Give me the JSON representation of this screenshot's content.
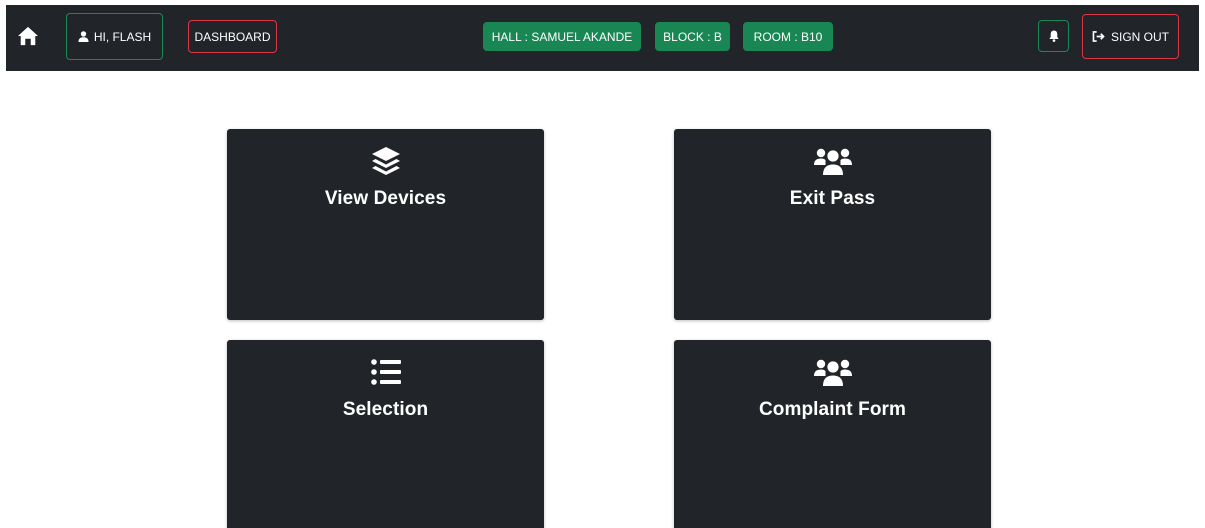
{
  "navbar": {
    "home_icon": "home-icon",
    "user_button": {
      "label": "HI, FLASH",
      "icon": "user-icon"
    },
    "dashboard_button": {
      "label": "DASHBOARD"
    },
    "badges": {
      "hall": "HALL : SAMUEL AKANDE",
      "block": "BLOCK : B",
      "room": "ROOM : B10"
    },
    "bell_icon": "bell-icon",
    "signout_button": {
      "label": "SIGN OUT",
      "icon": "sign-out-icon"
    }
  },
  "cards": [
    {
      "title": "View Devices",
      "icon": "layers-icon"
    },
    {
      "title": "Exit Pass",
      "icon": "users-icon"
    },
    {
      "title": "Selection",
      "icon": "list-icon"
    },
    {
      "title": "Complaint Form",
      "icon": "users-icon"
    }
  ],
  "colors": {
    "navbar_bg": "#212529",
    "success": "#198754",
    "danger": "#dc3545",
    "card_bg": "#212529",
    "text": "#ffffff"
  }
}
